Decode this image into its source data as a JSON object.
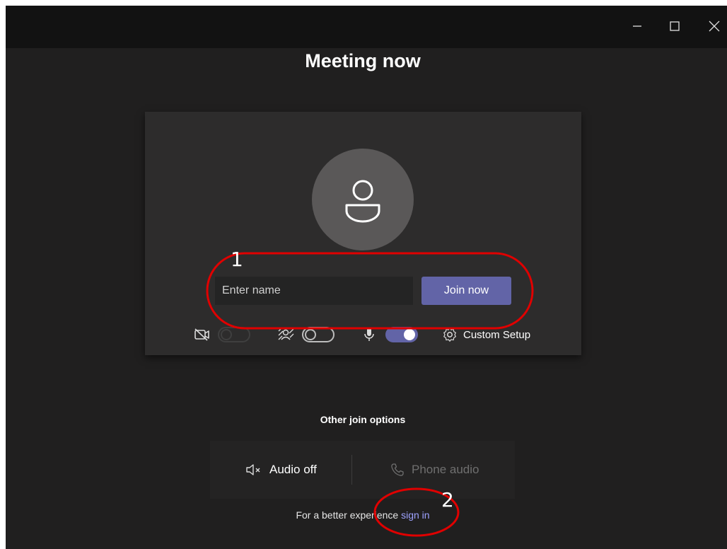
{
  "window": {
    "controls": [
      "minimize-icon",
      "maximize-icon",
      "close-icon"
    ]
  },
  "page": {
    "title": "Meeting now"
  },
  "prejoin": {
    "avatar_icon": "person-icon",
    "name_placeholder": "Enter name",
    "join_label": "Join now",
    "camera_toggle": {
      "icon": "camera-off-icon",
      "state": "off",
      "enabled": false
    },
    "background_toggle": {
      "icon": "background-blur-icon",
      "state": "off"
    },
    "mic_toggle": {
      "icon": "microphone-icon",
      "state": "on"
    },
    "custom_setup_label": "Custom Setup",
    "custom_setup_icon": "gear-icon"
  },
  "other_options": {
    "title": "Other join options",
    "audio_off_label": "Audio off",
    "audio_off_icon": "speaker-off-icon",
    "phone_audio_label": "Phone audio",
    "phone_audio_icon": "phone-icon"
  },
  "footer": {
    "prefix": "For a better experience",
    "link": "sign in"
  },
  "annotations": {
    "marker_1": "1",
    "marker_2": "2"
  },
  "colors": {
    "accent": "#6264a7",
    "link": "#9ea2ff",
    "annotation": "#e00000",
    "background": "#201f1f",
    "card": "#2d2c2c"
  }
}
